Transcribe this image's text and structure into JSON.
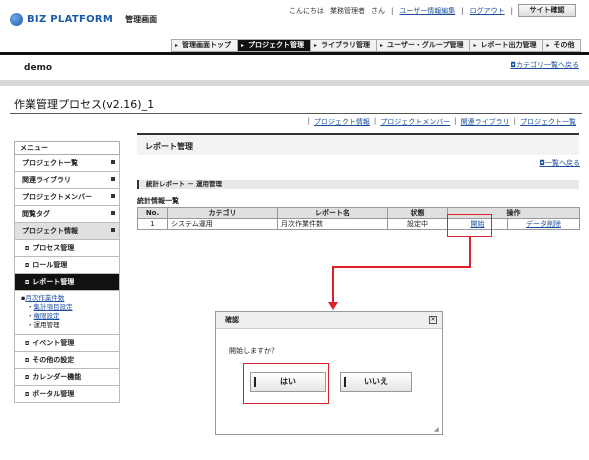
{
  "header": {
    "logo_text": "BIZ PLATFORM",
    "admin_label": "管理画面",
    "greeting": "こんにちは",
    "user_name": "業務管理者",
    "honorific": "さん",
    "user_edit_link": "ユーザー情報編集",
    "logout_link": "ログアウト",
    "site_confirm": "サイト確認"
  },
  "topnav": [
    {
      "label": "管理画面トップ",
      "active": false
    },
    {
      "label": "プロジェクト管理",
      "active": true
    },
    {
      "label": "ライブラリ管理",
      "active": false
    },
    {
      "label": "ユーザー・グループ管理",
      "active": false
    },
    {
      "label": "レポート出力管理",
      "active": false
    },
    {
      "label": "その他",
      "active": false
    }
  ],
  "category": "demo",
  "category_back": "カテゴリ一覧へ戻る",
  "project_title": "作業管理プロセス(v2.16)_1",
  "project_links": [
    "プロジェクト情報",
    "プロジェクトメンバー",
    "関連ライブラリ",
    "プロジェクト一覧"
  ],
  "sidebar": {
    "header": "メニュー",
    "items": [
      {
        "label": "プロジェクト一覧"
      },
      {
        "label": "関連ライブラリ"
      },
      {
        "label": "プロジェクトメンバー"
      },
      {
        "label": "閲覧タグ"
      },
      {
        "label": "プロジェクト情報"
      },
      {
        "label": "プロセス管理"
      },
      {
        "label": "ロール管理"
      },
      {
        "label": "レポート管理"
      },
      {
        "label": "イベント管理"
      },
      {
        "label": "その他の設定"
      },
      {
        "label": "カレンダー機能"
      },
      {
        "label": "ポータル管理"
      }
    ],
    "report_sub": {
      "parent": "月次作業件数",
      "children": [
        "集計項目設定",
        "権限設定",
        "運用管理"
      ]
    }
  },
  "main": {
    "heading": "レポート管理",
    "back_link": "一覧へ戻る",
    "subheading": "統計レポート － 運用管理",
    "list_label": "統計情報一覧",
    "table": {
      "columns": [
        "No.",
        "カテゴリ",
        "レポート名",
        "状態",
        "操作"
      ],
      "rows": [
        {
          "no": "1",
          "category": "システム運用",
          "name": "月次作業件数",
          "status": "設定中",
          "action1": "開始",
          "action2": "データ削除"
        }
      ]
    }
  },
  "dialog": {
    "title": "確認",
    "message": "開始しますか？",
    "yes": "はい",
    "no": "いいえ",
    "close_icon": "close-icon"
  },
  "colors": {
    "highlight": "#e0202a",
    "link": "#1a4fa0",
    "active_tab": "#111111"
  }
}
